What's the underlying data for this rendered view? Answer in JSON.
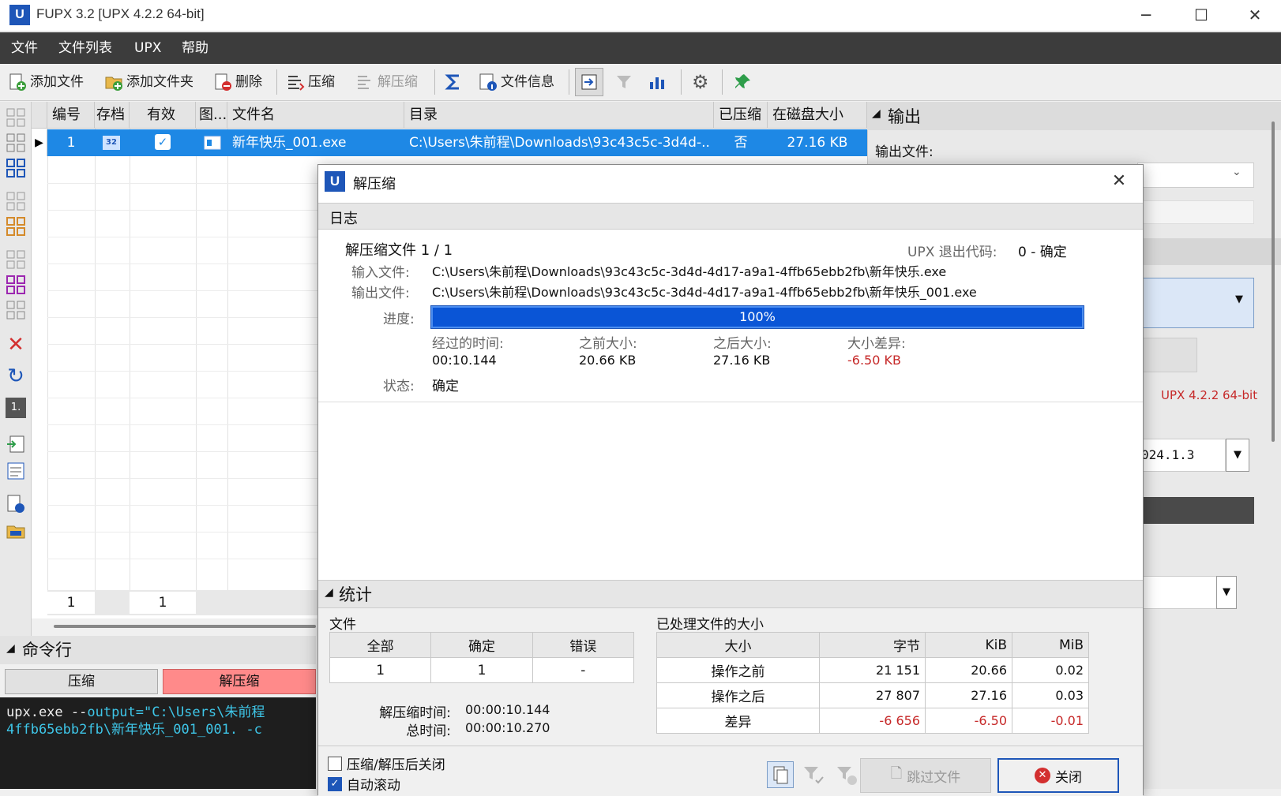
{
  "window": {
    "title": "FUPX 3.2    [UPX 4.2.2 64-bit]",
    "logo": "U"
  },
  "menu": [
    "文件",
    "文件列表",
    "UPX",
    "帮助"
  ],
  "toolbar": {
    "add_file": "添加文件",
    "add_folder": "添加文件夹",
    "delete": "删除",
    "compress": "压缩",
    "decompress": "解压缩",
    "file_info": "文件信息"
  },
  "grid": {
    "headers": [
      "编号",
      "存档",
      "有效",
      "图...",
      "文件名",
      "目录",
      "已压缩",
      "在磁盘大小"
    ],
    "row": {
      "num": "1",
      "arch": "32",
      "icon_name": "exe-icon",
      "filename": "新年快乐_001.exe",
      "dir": "C:\\Users\\朱前程\\Downloads\\93c43c5c-3d4d-...",
      "compressed": "否",
      "size": "27.16 KB"
    },
    "footer": {
      "count": "1",
      "valid": "1"
    }
  },
  "right_panel": {
    "output_title": "输出",
    "output_file_label": "输出文件:",
    "upx_version": "UPX 4.2.2 64-bit",
    "version_field": "024.1.3"
  },
  "cmdline": {
    "title": "命令行",
    "compress_btn": "压缩",
    "decompress_btn": "解压缩",
    "line1_a": "upx.exe --",
    "line1_b": "output=\"C:\\Users\\朱前程",
    "line2": "4ffb65ebb2fb\\新年快乐_001_001. -c"
  },
  "dialog": {
    "title": "解压缩",
    "log_label": "日志",
    "heading": "解压缩文件 1 / 1",
    "exit_code_label": "UPX 退出代码:",
    "exit_code_value": "0 - 确定",
    "input_label": "输入文件:",
    "input_value": "C:\\Users\\朱前程\\Downloads\\93c43c5c-3d4d-4d17-a9a1-4ffb65ebb2fb\\新年快乐.exe",
    "output_label": "输出文件:",
    "output_value": "C:\\Users\\朱前程\\Downloads\\93c43c5c-3d4d-4d17-a9a1-4ffb65ebb2fb\\新年快乐_001.exe",
    "progress_label": "进度:",
    "progress_text": "100%",
    "progress_value": 1.0,
    "elapsed_label": "经过的时间:",
    "elapsed_value": "00:10.144",
    "before_label": "之前大小:",
    "before_value": "20.66 KB",
    "after_label": "之后大小:",
    "after_value": "27.16 KB",
    "diff_label": "大小差异:",
    "diff_value": "-6.50 KB",
    "status_label": "状态:",
    "status_value": "确定",
    "stats_title": "统计",
    "files_label": "文件",
    "files_headers": [
      "全部",
      "确定",
      "错误"
    ],
    "files_values": [
      "1",
      "1",
      "-"
    ],
    "decomp_time_label": "解压缩时间:",
    "decomp_time_value": "00:00:10.144",
    "total_time_label": "总时间:",
    "total_time_value": "00:00:10.270",
    "sizes_label": "已处理文件的大小",
    "sizes_headers": [
      "大小",
      "字节",
      "KiB",
      "MiB"
    ],
    "sizes_rows": [
      [
        "操作之前",
        "21 151",
        "20.66",
        "0.02"
      ],
      [
        "操作之后",
        "27 807",
        "27.16",
        "0.03"
      ],
      [
        "差异",
        "-6 656",
        "-6.50",
        "-0.01"
      ]
    ],
    "close_after_label": "压缩/解压后关闭",
    "auto_scroll_label": "自动滚动",
    "skip_btn": "跳过文件",
    "close_btn": "关闭"
  },
  "colors": {
    "accent": "#1e88e5",
    "progress": "#0a55d6",
    "error": "#c62828"
  }
}
